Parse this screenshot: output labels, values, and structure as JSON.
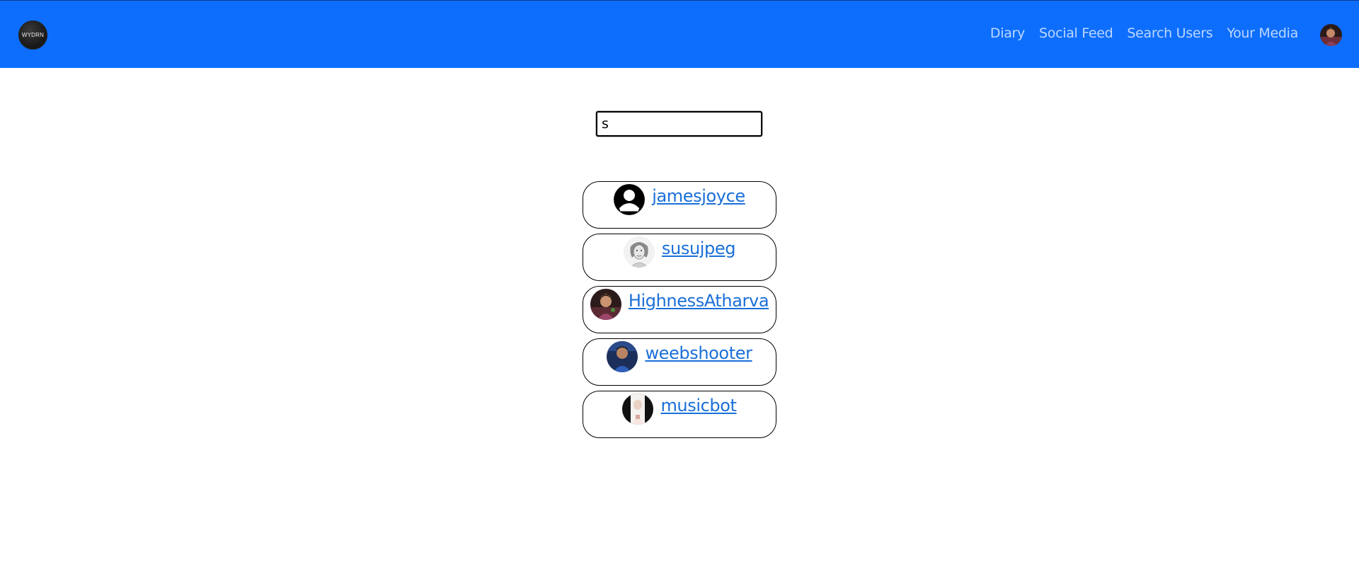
{
  "brand": {
    "logo_text": "WYDRN"
  },
  "nav": {
    "links": [
      {
        "label": "Diary"
      },
      {
        "label": "Social Feed"
      },
      {
        "label": "Search Users"
      },
      {
        "label": "Your Media"
      }
    ],
    "avatar_icon": "profile-avatar"
  },
  "search": {
    "value": "s",
    "placeholder": ""
  },
  "results": [
    {
      "username": "jamesjoyce",
      "avatar": "default-user-icon"
    },
    {
      "username": "susujpeg",
      "avatar": "sketch-portrait"
    },
    {
      "username": "HighnessAtharva",
      "avatar": "photo-portrait"
    },
    {
      "username": "weebshooter",
      "avatar": "photo-portrait"
    },
    {
      "username": "musicbot",
      "avatar": "photo-portrait"
    }
  ],
  "colors": {
    "navbar": "#0d6efd",
    "link": "#1a6fd8"
  }
}
